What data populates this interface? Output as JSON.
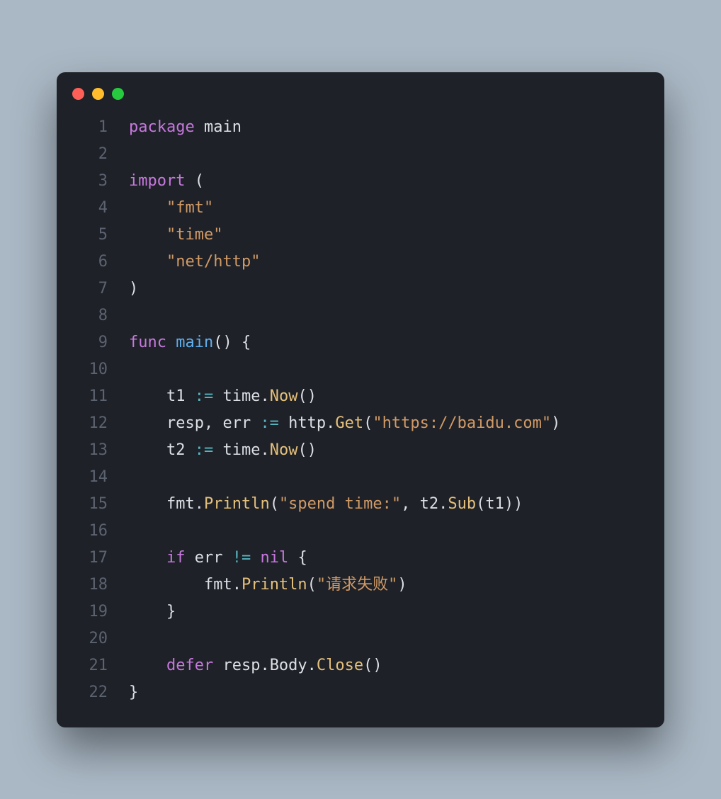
{
  "window": {
    "dots": [
      "red",
      "yellow",
      "green"
    ]
  },
  "code": {
    "line_numbers": [
      "1",
      "2",
      "3",
      "4",
      "5",
      "6",
      "7",
      "8",
      "9",
      "10",
      "11",
      "12",
      "13",
      "14",
      "15",
      "16",
      "17",
      "18",
      "19",
      "20",
      "21",
      "22"
    ],
    "lines": [
      {
        "tokens": [
          {
            "t": "kw",
            "v": "package"
          },
          {
            "t": "plain",
            "v": " main"
          }
        ]
      },
      {
        "tokens": []
      },
      {
        "tokens": [
          {
            "t": "kw",
            "v": "import"
          },
          {
            "t": "plain",
            "v": " ("
          }
        ]
      },
      {
        "tokens": [
          {
            "t": "plain",
            "v": "    "
          },
          {
            "t": "str",
            "v": "\"fmt\""
          }
        ]
      },
      {
        "tokens": [
          {
            "t": "plain",
            "v": "    "
          },
          {
            "t": "str",
            "v": "\"time\""
          }
        ]
      },
      {
        "tokens": [
          {
            "t": "plain",
            "v": "    "
          },
          {
            "t": "str",
            "v": "\"net/http\""
          }
        ]
      },
      {
        "tokens": [
          {
            "t": "plain",
            "v": ")"
          }
        ]
      },
      {
        "tokens": []
      },
      {
        "tokens": [
          {
            "t": "kw",
            "v": "func"
          },
          {
            "t": "plain",
            "v": " "
          },
          {
            "t": "fn",
            "v": "main"
          },
          {
            "t": "plain",
            "v": "() {"
          }
        ]
      },
      {
        "tokens": []
      },
      {
        "tokens": [
          {
            "t": "plain",
            "v": "    t1 "
          },
          {
            "t": "cyan",
            "v": ":="
          },
          {
            "t": "plain",
            "v": " time."
          },
          {
            "t": "call",
            "v": "Now"
          },
          {
            "t": "plain",
            "v": "()"
          }
        ]
      },
      {
        "tokens": [
          {
            "t": "plain",
            "v": "    resp, err "
          },
          {
            "t": "cyan",
            "v": ":="
          },
          {
            "t": "plain",
            "v": " http."
          },
          {
            "t": "call",
            "v": "Get"
          },
          {
            "t": "plain",
            "v": "("
          },
          {
            "t": "str",
            "v": "\"https://baidu.com\""
          },
          {
            "t": "plain",
            "v": ")"
          }
        ]
      },
      {
        "tokens": [
          {
            "t": "plain",
            "v": "    t2 "
          },
          {
            "t": "cyan",
            "v": ":="
          },
          {
            "t": "plain",
            "v": " time."
          },
          {
            "t": "call",
            "v": "Now"
          },
          {
            "t": "plain",
            "v": "()"
          }
        ]
      },
      {
        "tokens": []
      },
      {
        "tokens": [
          {
            "t": "plain",
            "v": "    fmt."
          },
          {
            "t": "call",
            "v": "Println"
          },
          {
            "t": "plain",
            "v": "("
          },
          {
            "t": "str",
            "v": "\"spend time:\""
          },
          {
            "t": "plain",
            "v": ", t2."
          },
          {
            "t": "call",
            "v": "Sub"
          },
          {
            "t": "plain",
            "v": "(t1))"
          }
        ]
      },
      {
        "tokens": []
      },
      {
        "tokens": [
          {
            "t": "plain",
            "v": "    "
          },
          {
            "t": "kw",
            "v": "if"
          },
          {
            "t": "plain",
            "v": " err "
          },
          {
            "t": "cyan",
            "v": "!="
          },
          {
            "t": "plain",
            "v": " "
          },
          {
            "t": "kw",
            "v": "nil"
          },
          {
            "t": "plain",
            "v": " {"
          }
        ]
      },
      {
        "tokens": [
          {
            "t": "plain",
            "v": "        fmt."
          },
          {
            "t": "call",
            "v": "Println"
          },
          {
            "t": "plain",
            "v": "("
          },
          {
            "t": "str",
            "v": "\"请求失败\""
          },
          {
            "t": "plain",
            "v": ")"
          }
        ]
      },
      {
        "tokens": [
          {
            "t": "plain",
            "v": "    }"
          }
        ]
      },
      {
        "tokens": []
      },
      {
        "tokens": [
          {
            "t": "plain",
            "v": "    "
          },
          {
            "t": "kw",
            "v": "defer"
          },
          {
            "t": "plain",
            "v": " resp.Body."
          },
          {
            "t": "call",
            "v": "Close"
          },
          {
            "t": "plain",
            "v": "()"
          }
        ]
      },
      {
        "tokens": [
          {
            "t": "plain",
            "v": "}"
          }
        ]
      }
    ]
  }
}
